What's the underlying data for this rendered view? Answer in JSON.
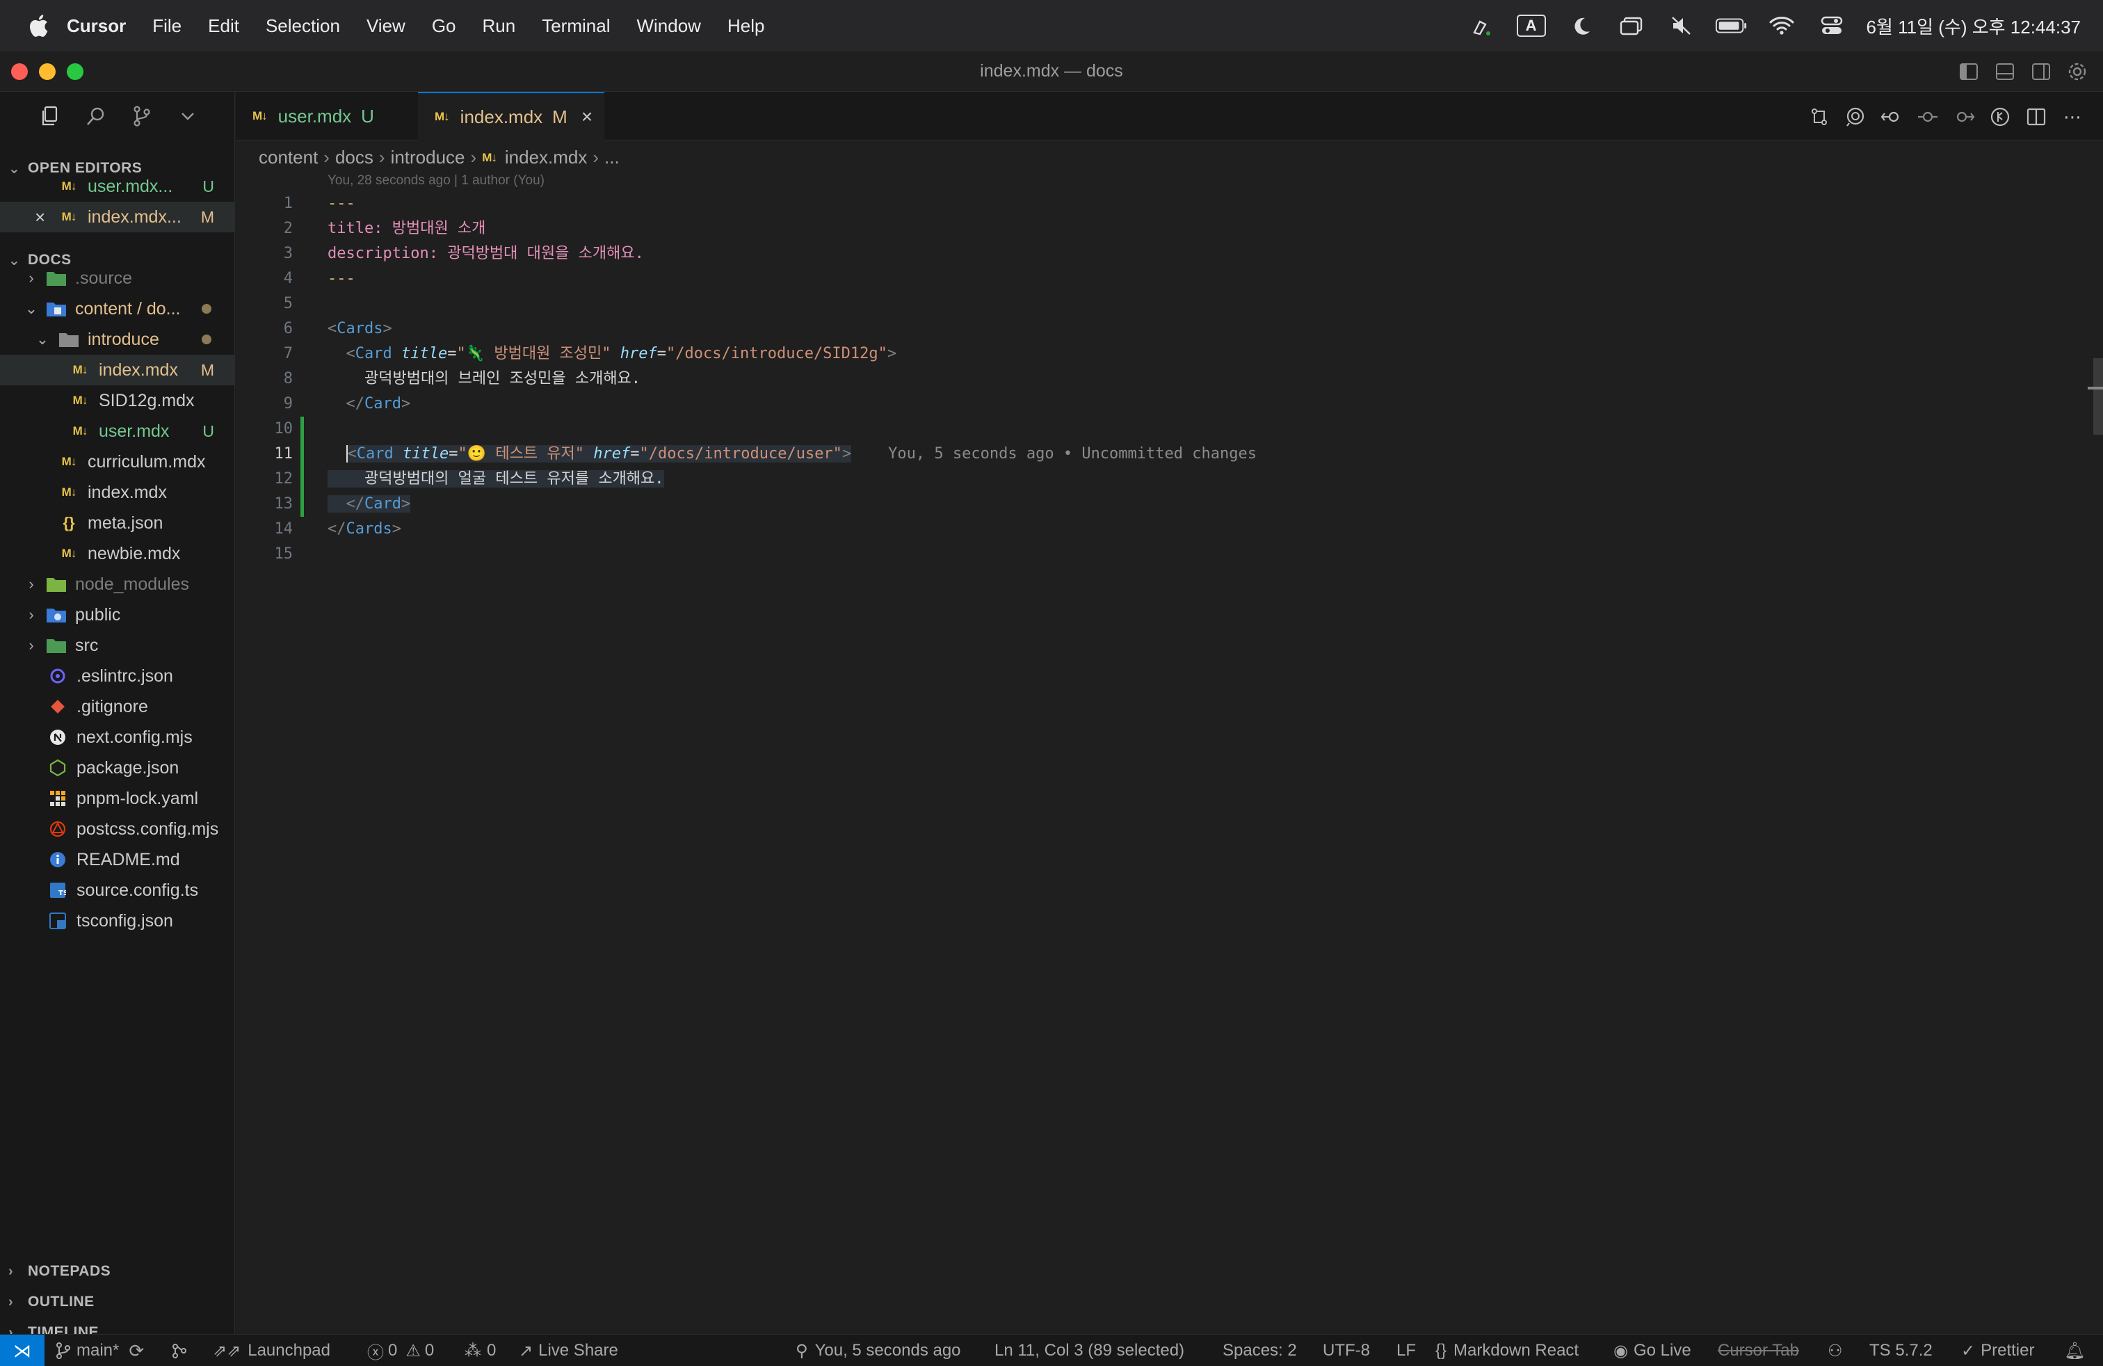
{
  "menubar": {
    "app": "Cursor",
    "items": [
      "File",
      "Edit",
      "Selection",
      "View",
      "Go",
      "Run",
      "Terminal",
      "Window",
      "Help"
    ],
    "input_indicator": "A",
    "clock": "6월 11일 (수) 오후 12:44:37"
  },
  "window": {
    "title": "index.mdx — docs"
  },
  "sidebar": {
    "open_editors_label": "OPEN EDITORS",
    "open_editors": [
      {
        "label": "user.mdx...",
        "badge": "U"
      },
      {
        "label": "index.mdx...",
        "badge": "M"
      }
    ],
    "docs_label": "DOCS",
    "tree": [
      {
        "label": ".source",
        "badge": ""
      },
      {
        "label": "content / do...",
        "badge": ""
      },
      {
        "label": "introduce",
        "badge": ""
      },
      {
        "label": "index.mdx",
        "badge": "M"
      },
      {
        "label": "SID12g.mdx",
        "badge": ""
      },
      {
        "label": "user.mdx",
        "badge": "U"
      },
      {
        "label": "curriculum.mdx",
        "badge": ""
      },
      {
        "label": "index.mdx",
        "badge": ""
      },
      {
        "label": "meta.json",
        "badge": ""
      },
      {
        "label": "newbie.mdx",
        "badge": ""
      },
      {
        "label": "node_modules",
        "badge": ""
      },
      {
        "label": "public",
        "badge": ""
      },
      {
        "label": "src",
        "badge": ""
      },
      {
        "label": ".eslintrc.json",
        "badge": ""
      },
      {
        "label": ".gitignore",
        "badge": ""
      },
      {
        "label": "next.config.mjs",
        "badge": ""
      },
      {
        "label": "package.json",
        "badge": ""
      },
      {
        "label": "pnpm-lock.yaml",
        "badge": ""
      },
      {
        "label": "postcss.config.mjs",
        "badge": ""
      },
      {
        "label": "README.md",
        "badge": ""
      },
      {
        "label": "source.config.ts",
        "badge": ""
      },
      {
        "label": "tsconfig.json",
        "badge": ""
      }
    ],
    "bottom_sections": [
      "NOTEPADS",
      "OUTLINE",
      "TIMELINE"
    ]
  },
  "tabs": [
    {
      "label": "user.mdx",
      "badge": "U"
    },
    {
      "label": "index.mdx",
      "badge": "M"
    }
  ],
  "breadcrumb": [
    "content",
    "docs",
    "introduce",
    "index.mdx",
    "..."
  ],
  "editor": {
    "blame_top": "You, 28 seconds ago | 1 author (You)",
    "line_numbers": [
      "1",
      "2",
      "3",
      "4",
      "5",
      "6",
      "7",
      "8",
      "9",
      "10",
      "11",
      "12",
      "13",
      "14",
      "15"
    ],
    "lines": {
      "l1": "---",
      "l2_key": "title:",
      "l2_val": " 방범대원 소개",
      "l3_key": "description:",
      "l3_val": " 광덕방범대 대원을 소개해요.",
      "l4": "---",
      "l6_tag": "Cards",
      "l7_tag": "Card",
      "l7_attr1": "title",
      "l7_val1": "\"🦎 방범대원 조성민\"",
      "l7_attr2": "href",
      "l7_val2": "\"/docs/introduce/SID12g\"",
      "l8": "광덕방범대의 브레인 조성민을 소개해요.",
      "l9_tag": "Card",
      "l11_tag": "Card",
      "l11_attr1": "title",
      "l11_val1": "\"🙂 테스트 유저\"",
      "l11_attr2": "href",
      "l11_val2": "\"/docs/introduce/user\"",
      "l11_blame": "You, 5 seconds ago • Uncommitted changes",
      "l12": "광덕방범대의 얼굴 테스트 유저를 소개해요.",
      "l13_tag": "Card",
      "l14_tag": "Cards"
    }
  },
  "statusbar": {
    "branch": "main*",
    "launchpad": "Launchpad",
    "errors": "0",
    "warnings": "0",
    "ports": "0",
    "live_share": "Live Share",
    "blame": "You, 5 seconds ago",
    "position": "Ln 11, Col 3 (89 selected)",
    "spaces": "Spaces: 2",
    "encoding": "UTF-8",
    "eol": "LF",
    "language": "Markdown React",
    "go_live": "Go Live",
    "cursor_tab": "Cursor Tab",
    "ts_version": "TS 5.7.2",
    "prettier": "Prettier"
  },
  "colors": {
    "accent": "#0078d4",
    "untracked": "#73c991",
    "modified": "#e2c08d",
    "gutter_added": "#2ea043"
  }
}
